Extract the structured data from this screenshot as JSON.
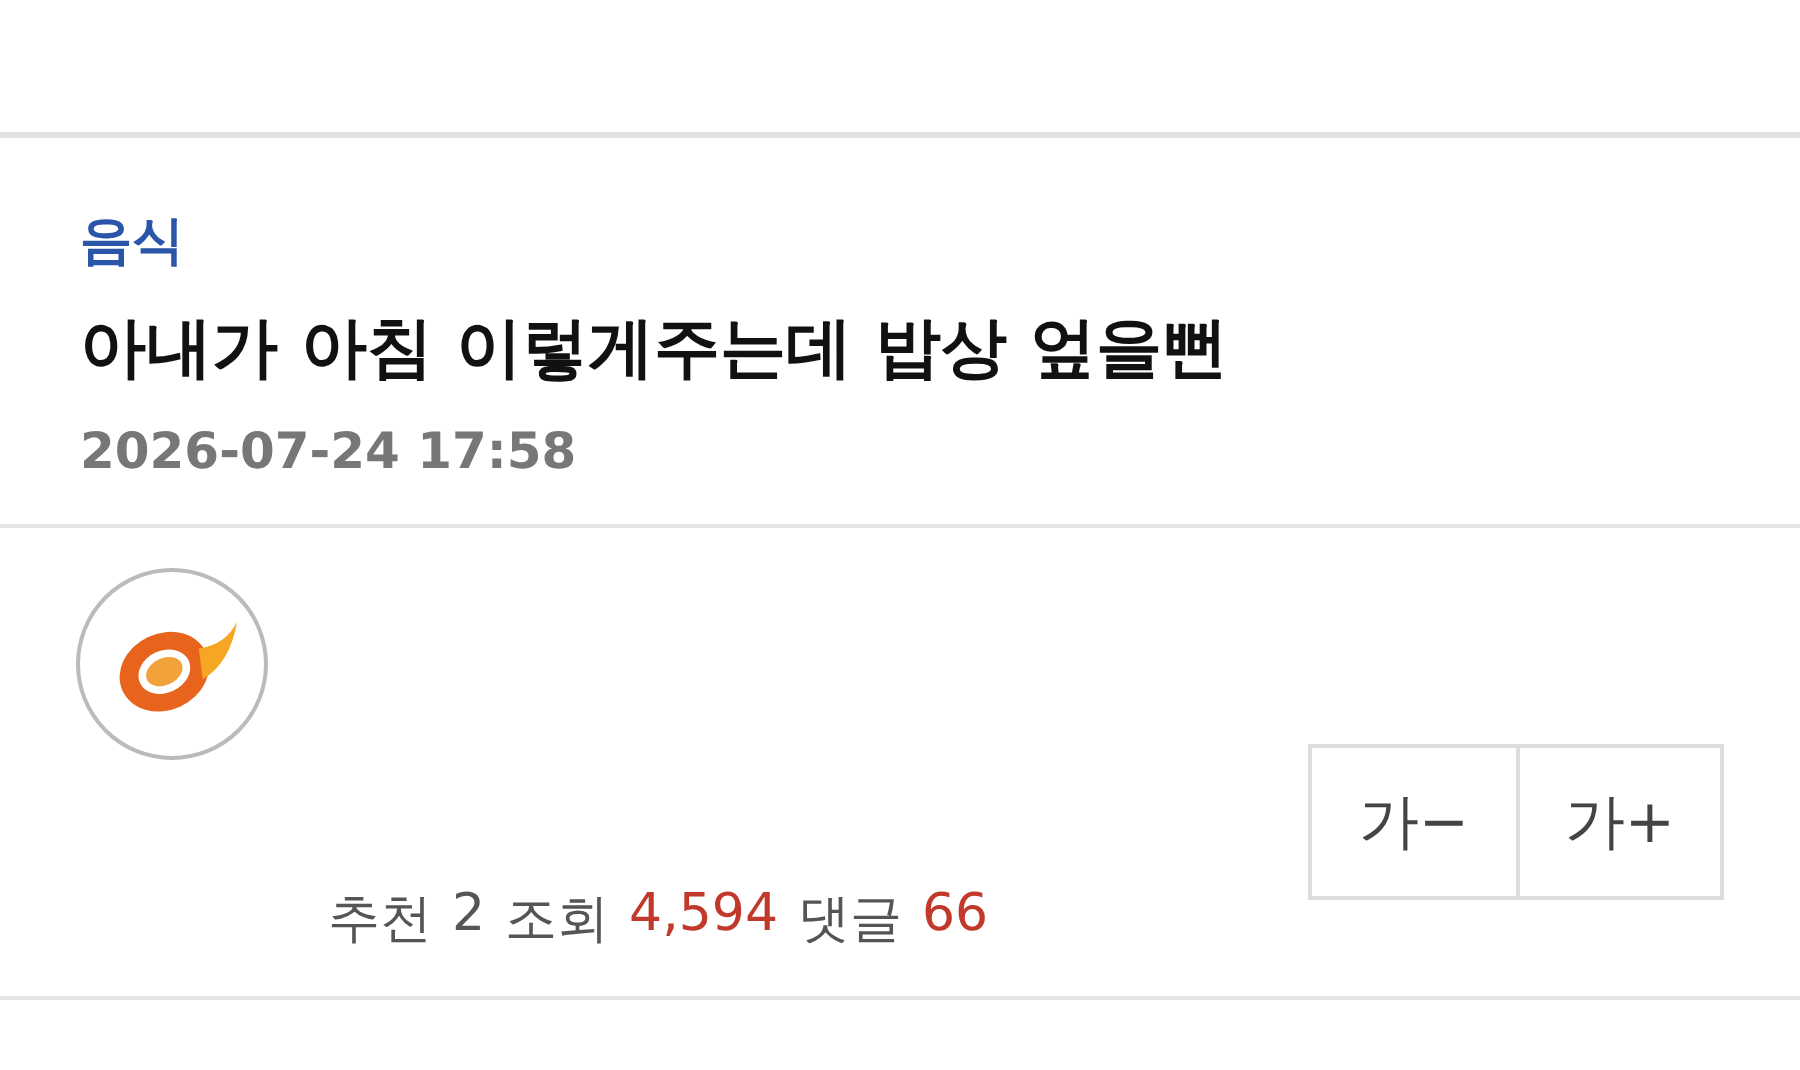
{
  "post": {
    "category": "음식",
    "title": "아내가 아침 이렇게주는데 밥상 엎을뻔",
    "date": "2026-07-24 17:58"
  },
  "stats": [
    {
      "label": "추천",
      "value": "2",
      "color": "#555555"
    },
    {
      "label": "조회",
      "value": "4,594",
      "color": "#c0392b"
    },
    {
      "label": "댓글",
      "value": "66",
      "color": "#c0392b"
    }
  ],
  "font_buttons": [
    "가−",
    "가+"
  ]
}
